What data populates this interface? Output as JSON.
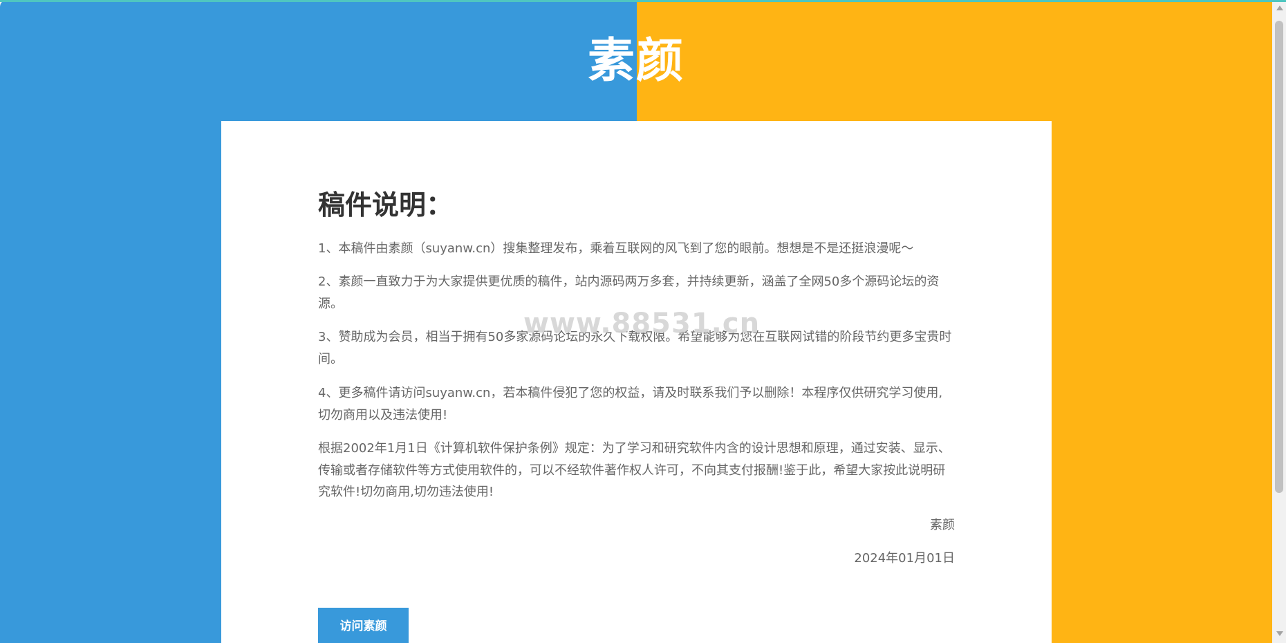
{
  "site": {
    "title": "素颜"
  },
  "article": {
    "heading": "稿件说明：",
    "paragraphs": [
      "1、本稿件由素颜（suyanw.cn）搜集整理发布，乘着互联网的风飞到了您的眼前。想想是不是还挺浪漫呢～",
      "2、素颜一直致力于为大家提供更优质的稿件，站内源码两万多套，并持续更新，涵盖了全网50多个源码论坛的资源。",
      "3、赞助成为会员，相当于拥有50多家源码论坛的永久下载权限。希望能够为您在互联网试错的阶段节约更多宝贵时间。",
      "4、更多稿件请访问suyanw.cn，若本稿件侵犯了您的权益，请及时联系我们予以删除！本程序仅供研究学习使用,切勿商用以及违法使用!",
      "根据2002年1月1日《计算机软件保护条例》规定：为了学习和研究软件内含的设计思想和原理，通过安装、显示、传输或者存储软件等方式使用软件的，可以不经软件著作权人许可，不向其支付报酬!鉴于此，希望大家按此说明研究软件!切勿商用,切勿违法使用!"
    ],
    "signature": "素颜",
    "date": "2024年01月01日"
  },
  "actions": {
    "visit_label": "访问素颜"
  },
  "watermark": {
    "text": "www.88531.cn"
  },
  "colors": {
    "left_panel": "#3899DB",
    "right_panel": "#FFB414",
    "top_accent": "#4FC6C0",
    "button": "#3899DB",
    "heading_text": "#333333",
    "body_text": "#666666"
  }
}
